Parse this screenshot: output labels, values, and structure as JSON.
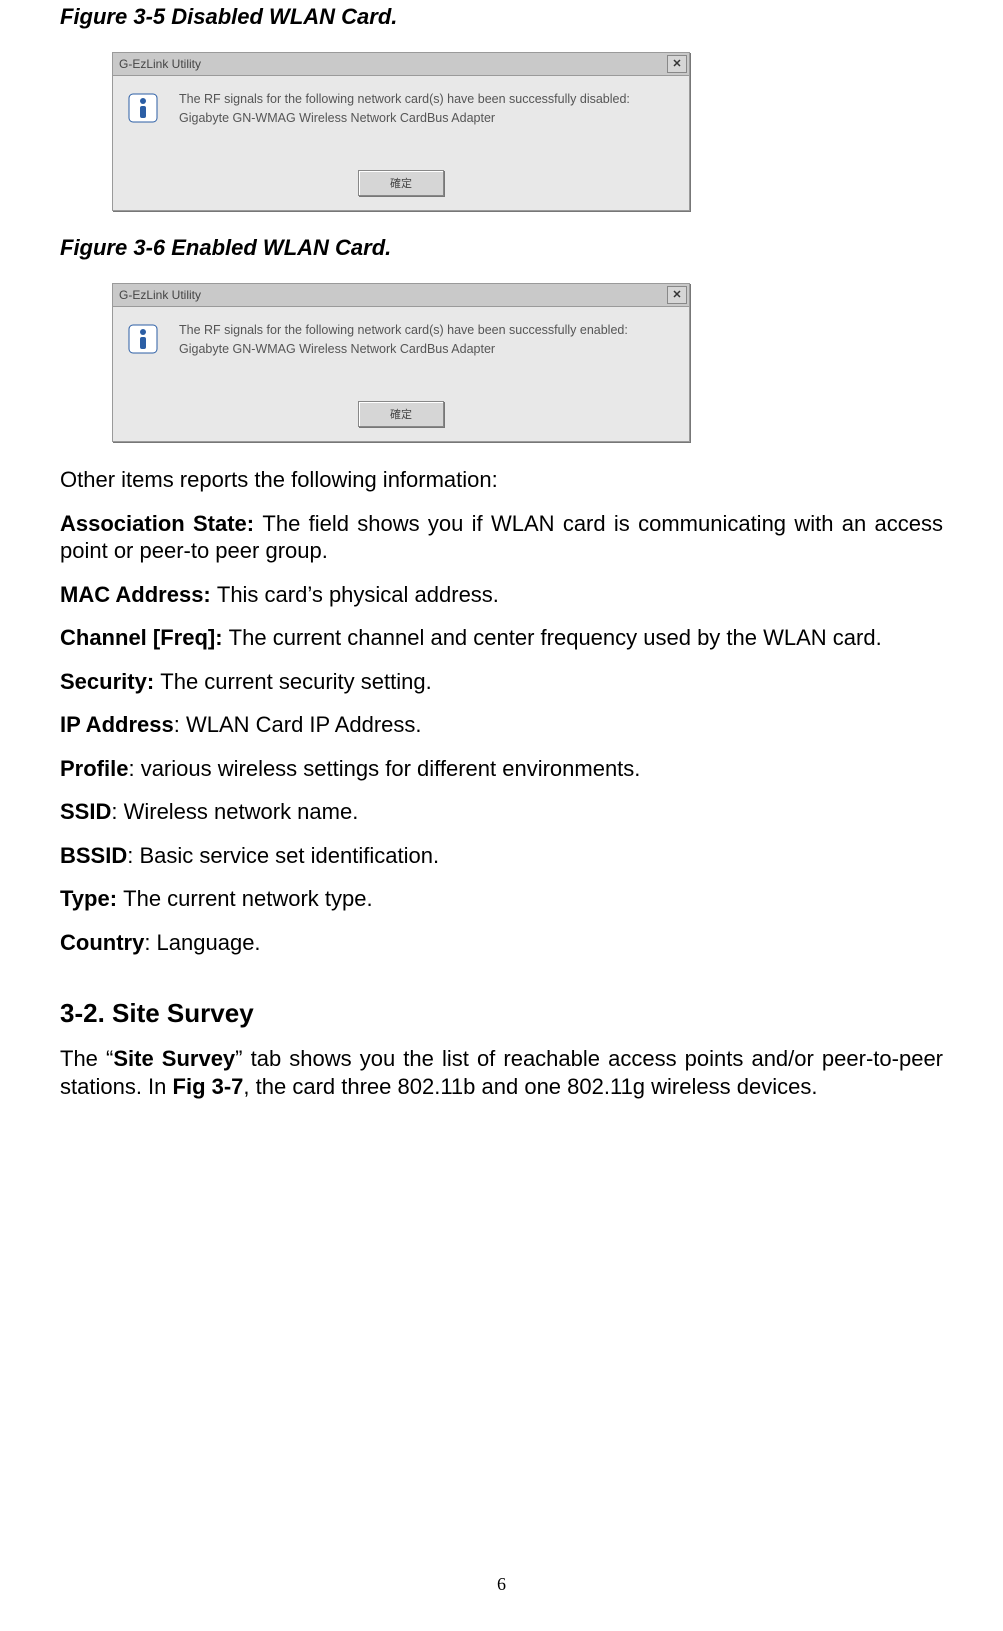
{
  "figures": {
    "fig1_caption": "Figure 3-5    Disabled WLAN Card.",
    "fig2_caption": "Figure 3-6    Enabled WLAN Card."
  },
  "dialog1": {
    "title": "G-EzLink Utility",
    "line1": "The RF signals for the following network card(s) have been successfully disabled:",
    "line2": "Gigabyte GN-WMAG Wireless Network CardBus Adapter",
    "ok": "確定"
  },
  "dialog2": {
    "title": "G-EzLink Utility",
    "line1": "The RF signals for the following network card(s) have been successfully enabled:",
    "line2": "Gigabyte GN-WMAG Wireless Network CardBus Adapter",
    "ok": "確定"
  },
  "intro": "Other items reports the following information:",
  "defs": {
    "assoc_label": "Association State: ",
    "assoc_text": "The field shows you if WLAN card is communicating with an access point or peer-to peer group.",
    "mac_label": "MAC Address: ",
    "mac_text": "This card’s physical address.",
    "chan_label": "Channel [Freq]: ",
    "chan_text": "The current channel and center frequency used by the WLAN card.",
    "sec_label": "Security: ",
    "sec_text": "The current security setting.",
    "ip_label": "IP Address",
    "ip_text": ": WLAN Card IP Address.",
    "profile_label": "Profile",
    "profile_text": ": various wireless settings for different environments.",
    "ssid_label": "SSID",
    "ssid_text": ": Wireless network name.",
    "bssid_label": "BSSID",
    "bssid_text": ": Basic service set identification.",
    "type_label": "Type: ",
    "type_text": "The current network type.",
    "country_label": "Country",
    "country_text": ": Language."
  },
  "section": {
    "heading": "3-2.    Site Survey",
    "p_before": "The “",
    "p_bold1": "Site Survey",
    "p_mid1": "” tab shows you the list of reachable access points and/or peer-to-peer stations. In ",
    "p_bold2": "Fig 3-7",
    "p_after": ", the card three 802.11b and one 802.11g wireless devices."
  },
  "page_number": "6"
}
